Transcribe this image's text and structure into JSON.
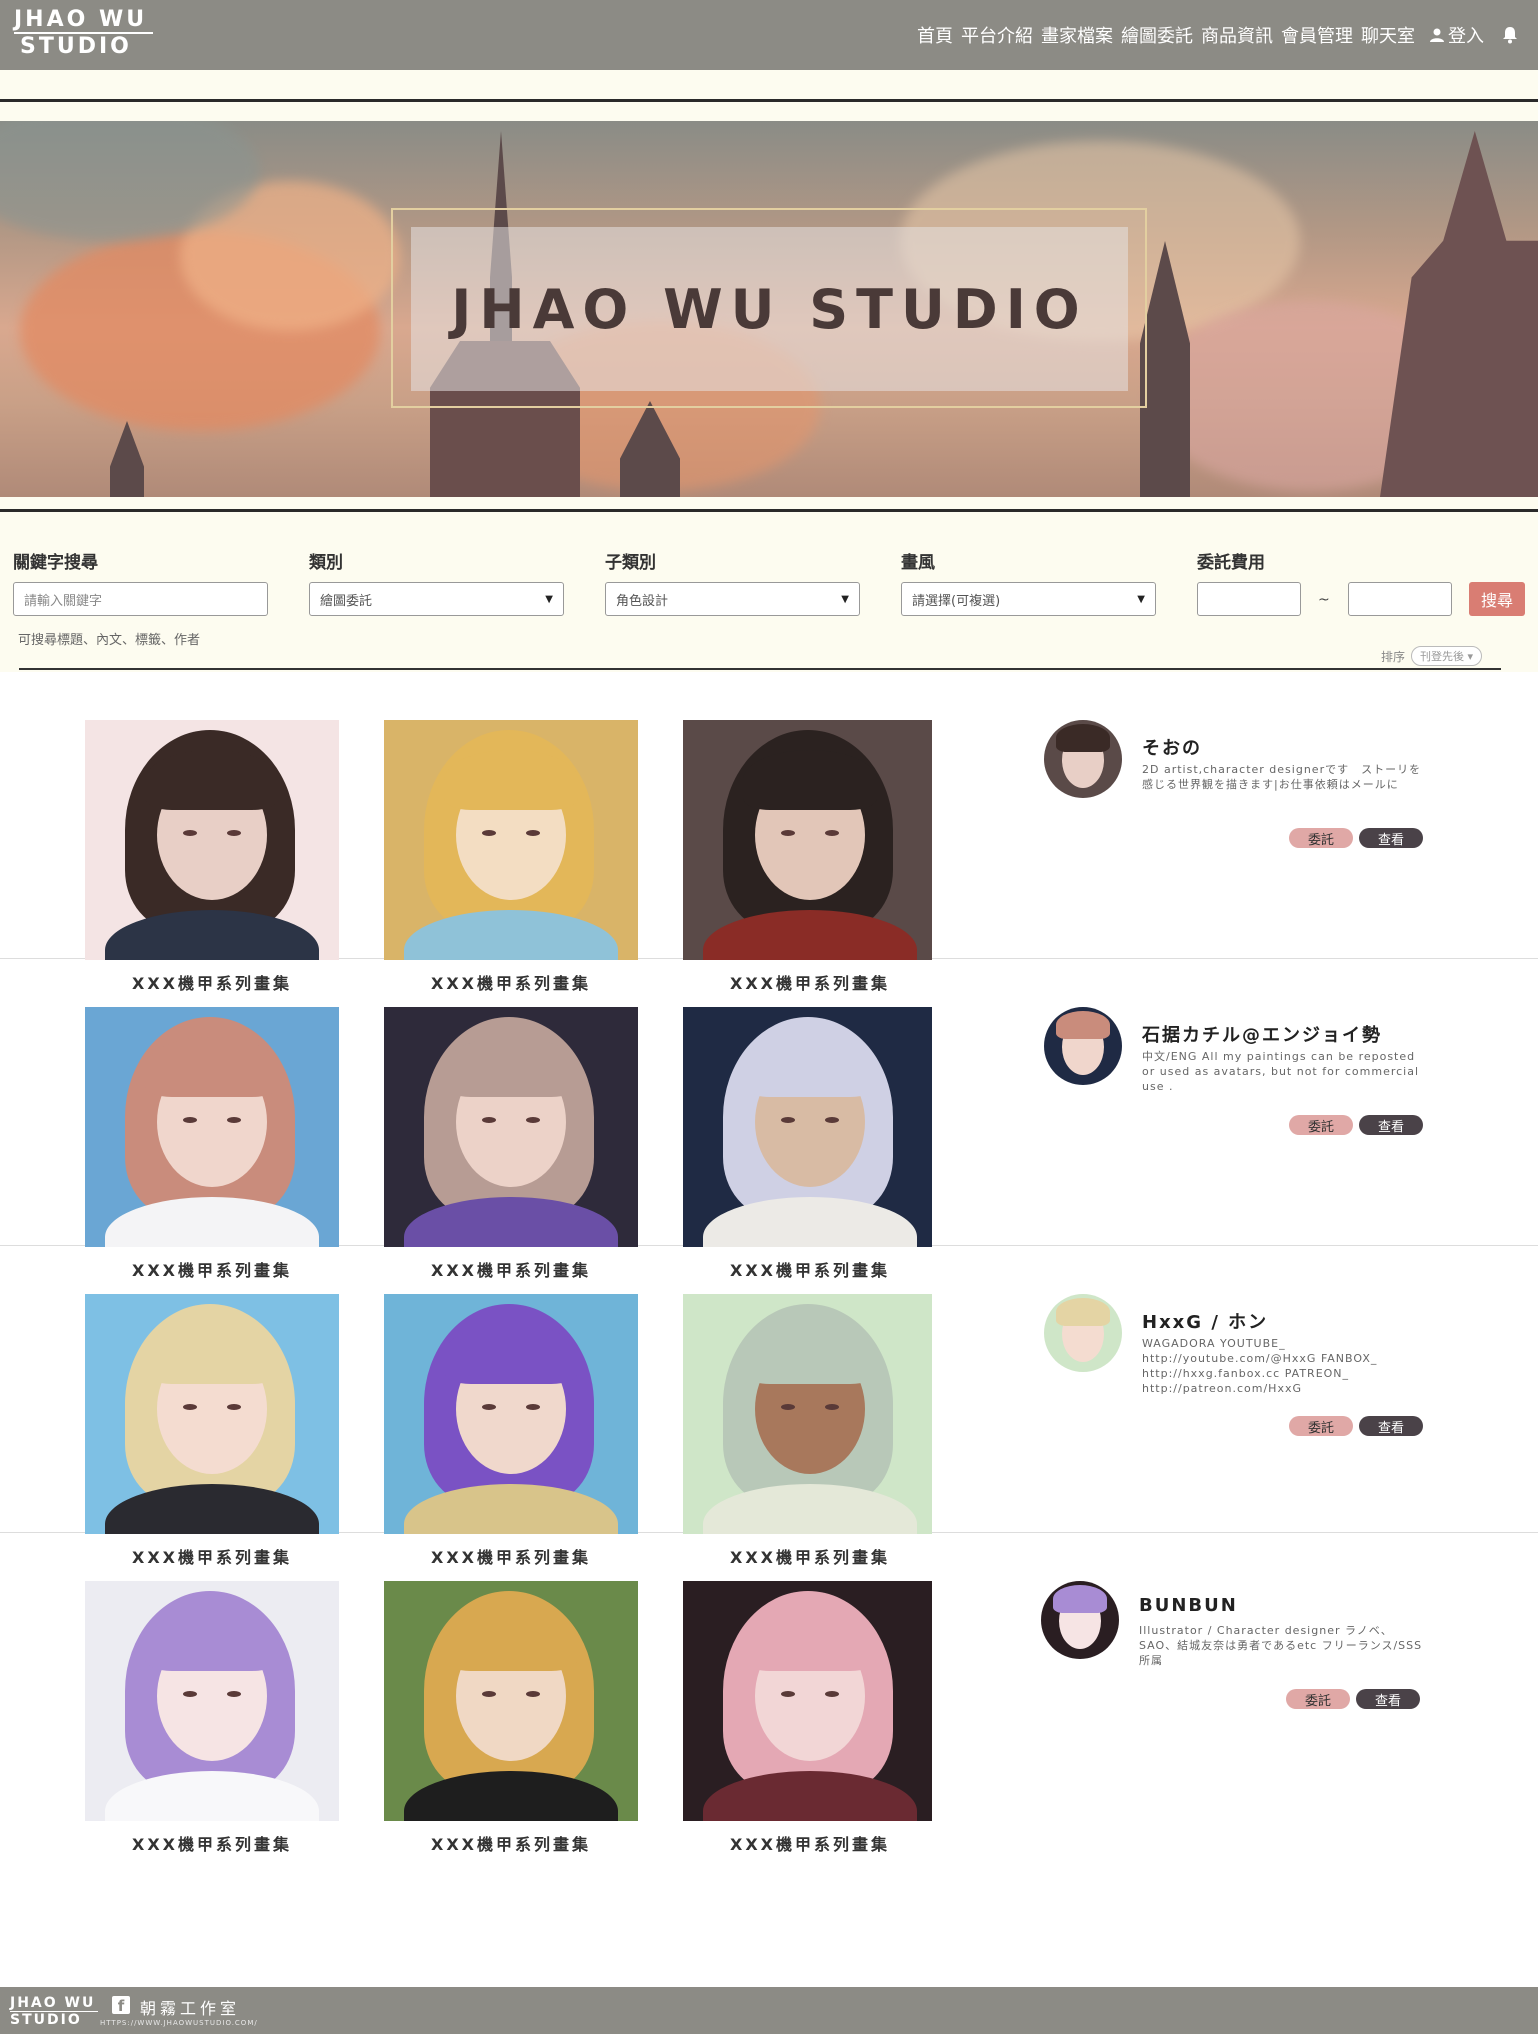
{
  "header": {
    "logo_line1": "JHAO WU",
    "logo_line2": "STUDIO",
    "nav": [
      "首頁",
      "平台介紹",
      "畫家檔案",
      "繪圖委託",
      "商品資訊",
      "會員管理",
      "聊天室"
    ],
    "login": "登入"
  },
  "banner": {
    "title": "JHAO WU STUDIO"
  },
  "filters": {
    "keyword_label": "關鍵字搜尋",
    "keyword_placeholder": "請輸入關鍵字",
    "category_label": "類別",
    "category_value": "繪圖委託",
    "subcategory_label": "子類別",
    "subcategory_value": "角色設計",
    "style_label": "畫風",
    "style_value": "請選擇(可複選)",
    "fee_label": "委託費用",
    "tilde": "~",
    "search_button": "搜尋",
    "hint": "可搜尋標題、內文、標籤、作者",
    "sort_label": "排序",
    "sort_value": "刊登先後"
  },
  "gallery": {
    "caption": "XXX機甲系列畫集",
    "rows": [
      {
        "artist": {
          "name": "そおの",
          "bio": "2D artist,character designerです　ストーリを感じる世界観を描きます|お仕事依頼はメールに"
        },
        "arts": [
          {
            "bg": "#f4e4e4",
            "hair": "#3a2a26",
            "skin": "#e8cfc6",
            "cloth": "#2c3446"
          },
          {
            "bg": "#d9b468",
            "hair": "#e3b759",
            "skin": "#f3ddc2",
            "cloth": "#8fc2d8"
          },
          {
            "bg": "#5a4a48",
            "hair": "#2b2220",
            "skin": "#e2c6b8",
            "cloth": "#8a2c26"
          }
        ]
      },
      {
        "artist": {
          "name": "石据カチル@エンジョイ勢",
          "bio": "中文/ENG All my paintings can be reposted or used as avatars, but not for commercial use ."
        },
        "arts": [
          {
            "bg": "#6aa6d4",
            "hair": "#c98c7c",
            "skin": "#f0d6cc",
            "cloth": "#f4f4f6"
          },
          {
            "bg": "#2e2a3a",
            "hair": "#b79c94",
            "skin": "#ecd2c8",
            "cloth": "#6a4fa6"
          },
          {
            "bg": "#1f2a44",
            "hair": "#cfd0e4",
            "skin": "#d8bba4",
            "cloth": "#eceae6"
          }
        ]
      },
      {
        "artist": {
          "name": "HxxG / ホン",
          "bio": "WAGADORA YOUTUBE_ http://youtube.com/@HxxG FANBOX_ http://hxxg.fanbox.cc PATREON_ http://patreon.com/HxxG"
        },
        "arts": [
          {
            "bg": "#7ec0e4",
            "hair": "#e4d4a4",
            "skin": "#f4dcd0",
            "cloth": "#2a2a30"
          },
          {
            "bg": "#6fb4d8",
            "hair": "#7a52c4",
            "skin": "#f0d8cc",
            "cloth": "#d8c48a"
          },
          {
            "bg": "#cfe6c8",
            "hair": "#b8c8b8",
            "skin": "#a8785c",
            "cloth": "#e4e8d8"
          }
        ]
      },
      {
        "artist": {
          "name": "BUNBUN",
          "bio": "Illustrator / Character designer ラノベ、SAO、結城友奈は勇者であるetc フリーランス/SSS所属"
        },
        "arts": [
          {
            "bg": "#ececf2",
            "hair": "#a88cd4",
            "skin": "#f6e4e4",
            "cloth": "#f8f8fa"
          },
          {
            "bg": "#6a8a4a",
            "hair": "#d8a850",
            "skin": "#f0d8c4",
            "cloth": "#1e1e1e"
          },
          {
            "bg": "#2a1e22",
            "hair": "#e4a8b4",
            "skin": "#f2d6d6",
            "cloth": "#6a2a32"
          }
        ]
      }
    ],
    "commission_button": "委託",
    "view_button": "查看"
  },
  "footer": {
    "logo_line1": "JHAO WU",
    "logo_line2": "STUDIO",
    "studio_name": "朝霧工作室",
    "url": "HTTPS://WWW.JHAOWUSTUDIO.COM/"
  }
}
